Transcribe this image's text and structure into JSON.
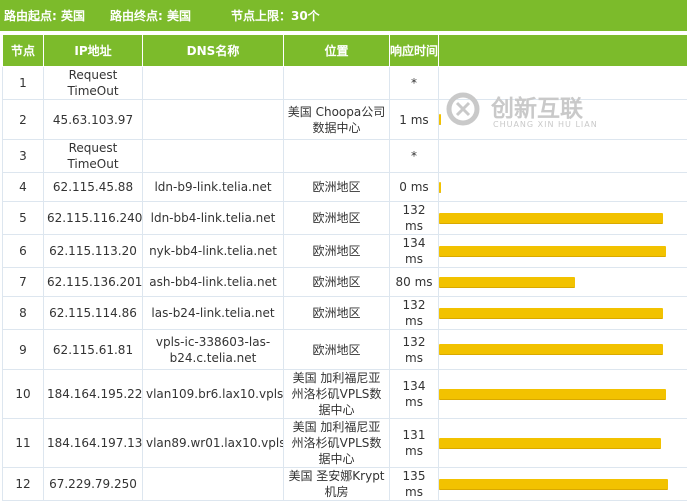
{
  "header": {
    "origin_label": "路由起点: 英国",
    "dest_label": "路由终点: 美国",
    "limit_label": "节点上限：30个"
  },
  "columns": {
    "hop": "节点",
    "ip": "IP地址",
    "dns": "DNS名称",
    "location": "位置",
    "latency": "响应时间",
    "bar": ""
  },
  "watermark": {
    "brand": "创新互联",
    "sub": "CHUANG XIN HU LIAN",
    "icon": "chuangxin-logo-icon"
  },
  "colors": {
    "accent": "#7cbb2b",
    "bar": "#f2c200",
    "border": "#dde6ef"
  },
  "rows": [
    {
      "hop": "1",
      "ip": "Request TimeOut",
      "dns": "",
      "location": "",
      "latency": "*",
      "ms": null
    },
    {
      "hop": "2",
      "ip": "45.63.103.97",
      "dns": "",
      "location": "美国 Choopa公司数据中心",
      "latency": "1 ms",
      "ms": 1
    },
    {
      "hop": "3",
      "ip": "Request TimeOut",
      "dns": "",
      "location": "",
      "latency": "*",
      "ms": null
    },
    {
      "hop": "4",
      "ip": "62.115.45.88",
      "dns": "ldn-b9-link.telia.net",
      "location": "欧洲地区",
      "latency": "0 ms",
      "ms": 0
    },
    {
      "hop": "5",
      "ip": "62.115.116.240",
      "dns": "ldn-bb4-link.telia.net",
      "location": "欧洲地区",
      "latency": "132 ms",
      "ms": 132
    },
    {
      "hop": "6",
      "ip": "62.115.113.20",
      "dns": "nyk-bb4-link.telia.net",
      "location": "欧洲地区",
      "latency": "134 ms",
      "ms": 134
    },
    {
      "hop": "7",
      "ip": "62.115.136.201",
      "dns": "ash-bb4-link.telia.net",
      "location": "欧洲地区",
      "latency": "80 ms",
      "ms": 80
    },
    {
      "hop": "8",
      "ip": "62.115.114.86",
      "dns": "las-b24-link.telia.net",
      "location": "欧洲地区",
      "latency": "132 ms",
      "ms": 132
    },
    {
      "hop": "9",
      "ip": "62.115.61.81",
      "dns": "vpls-ic-338603-las-b24.c.telia.net",
      "location": "欧洲地区",
      "latency": "132 ms",
      "ms": 132
    },
    {
      "hop": "10",
      "ip": "184.164.195.225",
      "dns": "vlan109.br6.lax10.vpls.net",
      "location": "美国 加利福尼亚州洛杉矶VPLS数据中心",
      "latency": "134 ms",
      "ms": 134
    },
    {
      "hop": "11",
      "ip": "184.164.197.131",
      "dns": "vlan89.wr01.lax10.vpls.net",
      "location": "美国 加利福尼亚州洛杉矶VPLS数据中心",
      "latency": "131 ms",
      "ms": 131
    },
    {
      "hop": "12",
      "ip": "67.229.79.250",
      "dns": "",
      "location": "美国 圣安娜Krypt机房",
      "latency": "135 ms",
      "ms": 135
    }
  ]
}
